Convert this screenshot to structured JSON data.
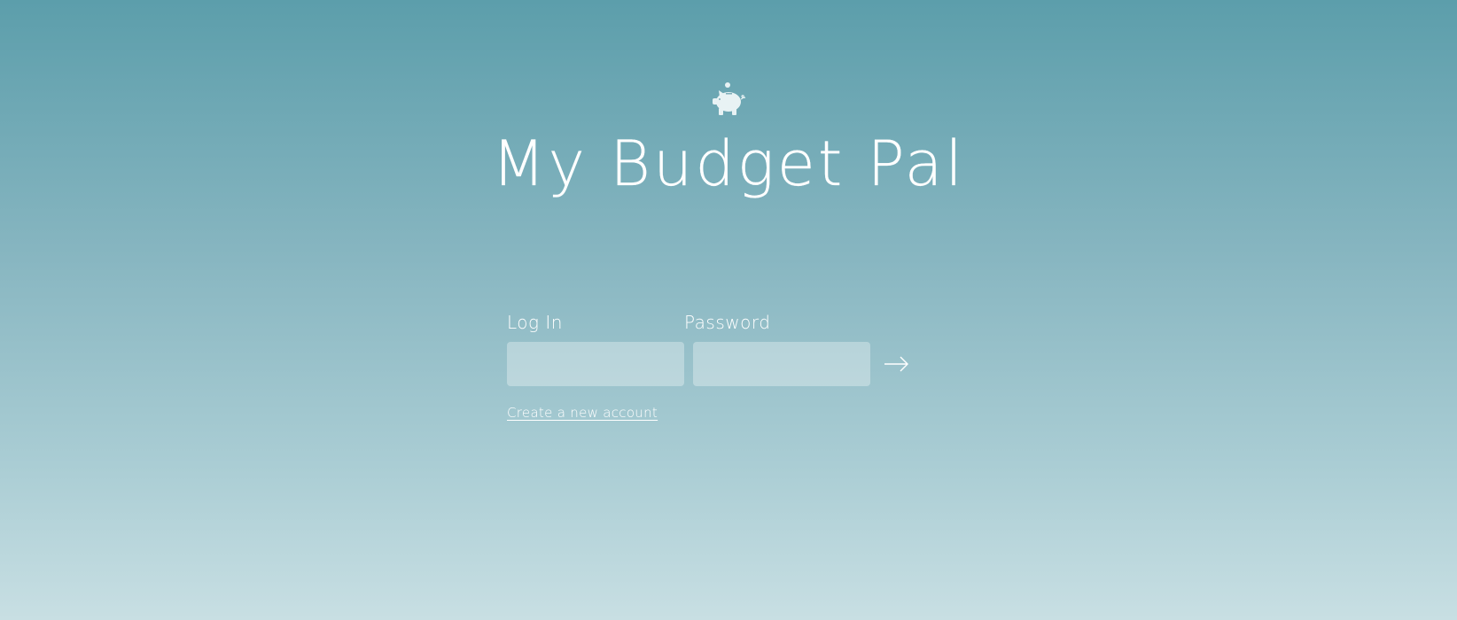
{
  "app": {
    "title": "My Budget Pal",
    "logo_icon": "piggy-bank-icon"
  },
  "login_form": {
    "login_label": "Log In",
    "login_value": "",
    "password_label": "Password",
    "password_value": "",
    "submit_icon": "arrow-right-icon",
    "create_account_link": "Create a new account"
  },
  "colors": {
    "background_top": "#5c9eab",
    "background_bottom": "#c8dfe3",
    "text": "#ffffff"
  }
}
